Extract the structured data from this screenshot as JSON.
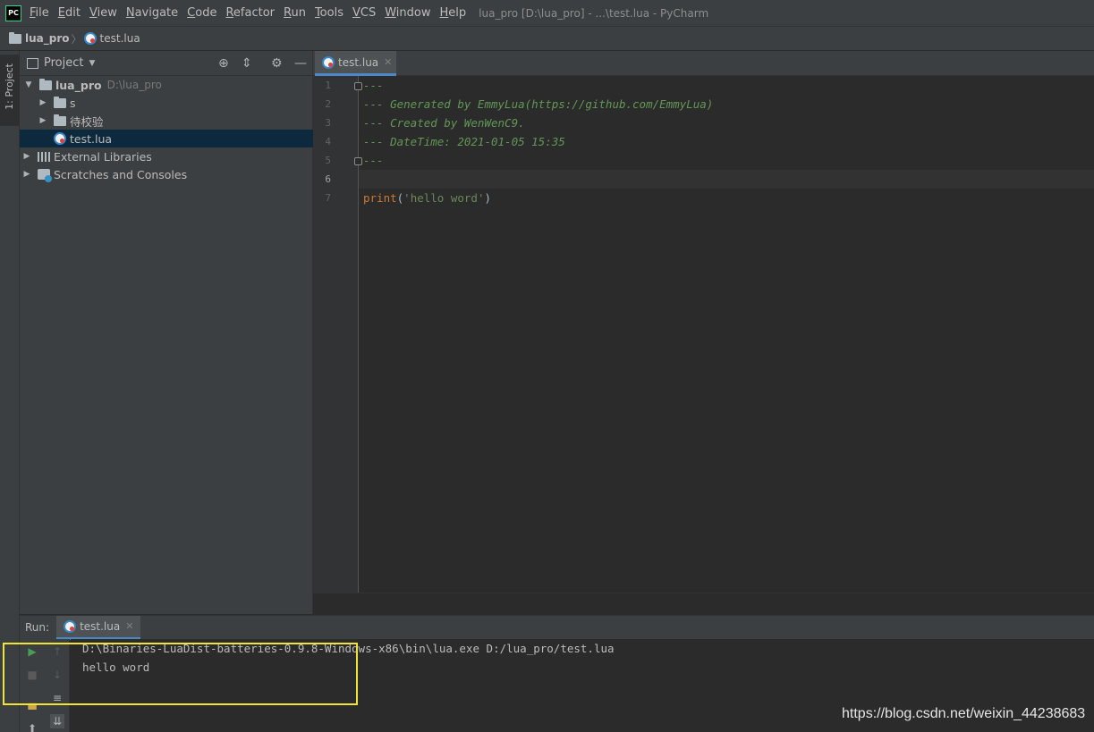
{
  "menubar": {
    "logo": "PC",
    "items": [
      {
        "mnemonic": "F",
        "rest": "ile"
      },
      {
        "mnemonic": "E",
        "rest": "dit"
      },
      {
        "mnemonic": "V",
        "rest": "iew"
      },
      {
        "mnemonic": "N",
        "rest": "avigate"
      },
      {
        "mnemonic": "C",
        "rest": "ode"
      },
      {
        "mnemonic": "R",
        "rest": "efactor"
      },
      {
        "mnemonic": "R",
        "rest": "un"
      },
      {
        "mnemonic": "T",
        "rest": "ools"
      },
      {
        "mnemonic": "V",
        "rest": "CS"
      },
      {
        "mnemonic": "W",
        "rest": "indow"
      },
      {
        "mnemonic": "H",
        "rest": "elp"
      }
    ],
    "window_title": "lua_pro [D:\\lua_pro] - ...\\test.lua - PyCharm"
  },
  "navbar": {
    "project": "lua_pro",
    "separator": "〉",
    "file": "test.lua"
  },
  "left_strip": {
    "project_tab": "1: Project"
  },
  "project_panel": {
    "title": "Project",
    "tree": [
      {
        "label": "lua_pro",
        "hint": "D:\\lua_pro",
        "kind": "folder",
        "expanded": true
      },
      {
        "label": "s",
        "kind": "folder",
        "expanded": false
      },
      {
        "label": "待校验",
        "kind": "folder",
        "expanded": false
      },
      {
        "label": "test.lua",
        "kind": "lua-file",
        "selected": true
      },
      {
        "label": "External Libraries",
        "kind": "libraries",
        "expanded": false
      },
      {
        "label": "Scratches and Consoles",
        "kind": "scratches",
        "expanded": false
      }
    ]
  },
  "editor": {
    "tab_label": "test.lua",
    "line_numbers": [
      "1",
      "2",
      "3",
      "4",
      "5",
      "6",
      "7"
    ],
    "lines": [
      "---",
      "--- Generated by EmmyLua(https://github.com/EmmyLua)",
      "--- Created by WenWenC9.",
      "--- DateTime: 2021-01-05 15:35",
      "---",
      "",
      "print('hello word')"
    ],
    "code_fn": "print",
    "code_open": "(",
    "code_str": "'hello word'",
    "code_close": ")",
    "current_line": "6"
  },
  "run_panel": {
    "label": "Run:",
    "tab_label": "test.lua",
    "console_lines": [
      "D:\\Binaries-LuaDist-batteries-0.9.8-Windows-x86\\bin\\lua.exe D:/lua_pro/test.lua",
      "hello word"
    ]
  },
  "watermark": "https://blog.csdn.net/weixin_44238683",
  "colors": {
    "accent": "#4a88c7",
    "highlight_box": "#f2e435",
    "comment": "#629755",
    "keyword": "#cc7832",
    "string": "#6a8759"
  }
}
